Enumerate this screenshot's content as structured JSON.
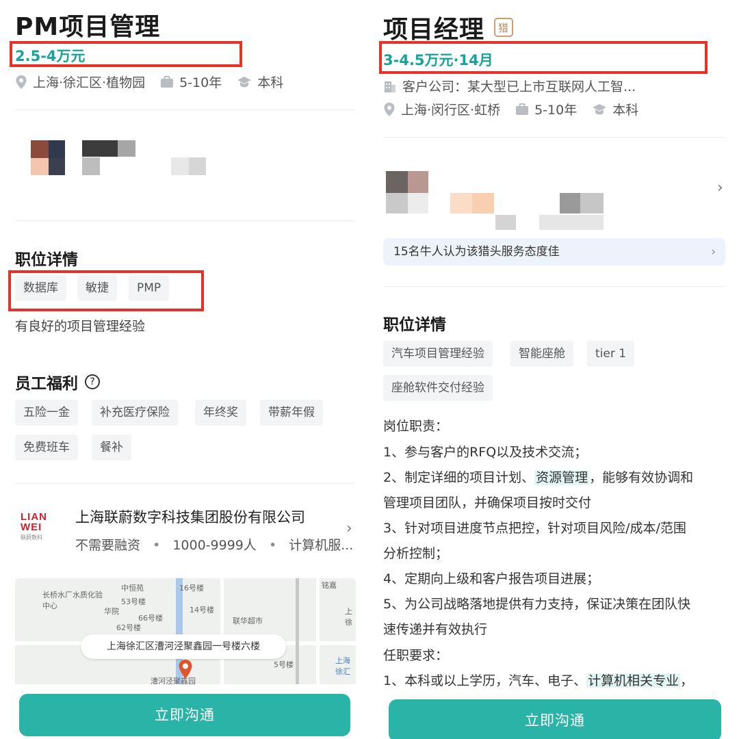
{
  "left": {
    "title": "PM项目管理",
    "salary": "2.5-4万元",
    "location": "上海·徐汇区·植物园",
    "experience": "5-10年",
    "education": "本科",
    "section_details": "职位详情",
    "tags": [
      "数据库",
      "敏捷",
      "PMP"
    ],
    "description": "有良好的项目管理经验",
    "section_benefits": "员工福利",
    "benefits": [
      "五险一金",
      "补充医疗保险",
      "年终奖",
      "带薪年假",
      "免费班车",
      "餐补"
    ],
    "company": {
      "logo_text": "LIAN WEI",
      "logo_sub": "联蔚数科",
      "name": "上海联蔚数字科技集团股份有限公司",
      "funding": "不需要融资",
      "size": "1000-9999人",
      "industry": "计算机服..."
    },
    "map": {
      "address": "上海徐汇区漕河泾聚鑫园一号楼六楼",
      "labels": [
        "中恒苑",
        "16号楼",
        "长桥水厂水质化验中心",
        "53号楼",
        "14号楼",
        "华院",
        "66号楼",
        "62号楼",
        "联华超市",
        "5号楼",
        "漕河泾聚鑫园",
        "上海徐汇",
        "铭嘉",
        "上徐"
      ]
    },
    "cta": "立即沟通"
  },
  "right": {
    "title": "项目经理",
    "hunter_badge": "猎",
    "salary": "3-4.5万元·14月",
    "client": "客户公司：某大型已上市互联网人工智...",
    "location": "上海·闵行区·虹桥",
    "experience": "5-10年",
    "education": "本科",
    "review_text": "15名牛人认为该猎头服务态度佳",
    "section_details": "职位详情",
    "tags": [
      "汽车项目管理经验",
      "智能座舱",
      "tier 1",
      "座舱软件交付经验"
    ],
    "body": {
      "duties_title": "岗位职责：",
      "line1": "1、参与客户的RFQ以及技术交流；",
      "line2_a": "2、制定详细的项目计划、",
      "line2_hl": "资源管理",
      "line2_b": "，能够有效协调和",
      "line3": "管理项目团队，并确保项目按时交付",
      "line4": "3、针对项目进度节点把控，针对项目风险/成本/范围",
      "line5": "分析控制；",
      "line6": "4、定期向上级和客户报告项目进展；",
      "line7": "5、为公司战略落地提供有力支持，保证决策在团队快",
      "line8": "速传递并有效执行",
      "req_title": "任职要求：",
      "line9_a": "1、本科或以上学历，汽车、电子、",
      "line9_hl": "计算机相关专业",
      "line9_b": "，"
    },
    "cta": "立即沟通"
  },
  "colors": {
    "accent": "#17a39a",
    "button": "#2ab3a7",
    "highlight_box": "#e8302a",
    "tag_bg": "#f3f4f6"
  }
}
